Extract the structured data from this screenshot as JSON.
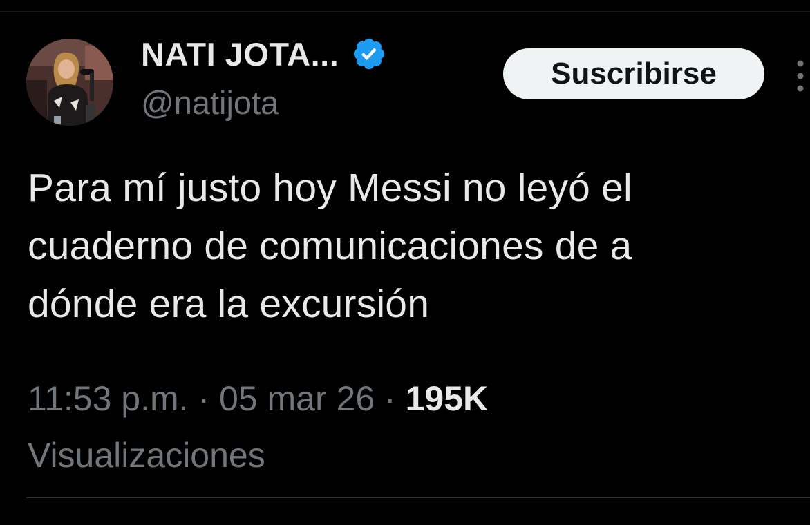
{
  "author": {
    "display_name": "NATI JOTA...",
    "handle": "@natijota",
    "verified": true,
    "avatar_icon": "profile-photo"
  },
  "actions": {
    "subscribe_label": "Suscribirse",
    "more_icon": "more-vertical-icon"
  },
  "tweet": {
    "text_lines": [
      "Para mí justo hoy Messi no leyó el",
      "cuaderno de comunicaciones de a",
      "dónde era la excursión"
    ],
    "time": "11:53 p.m.",
    "separator": "·",
    "date": "05 mar 26",
    "views_count": "195K",
    "views_label": "Visualizaciones"
  },
  "colors": {
    "background": "#000000",
    "primary_text": "#e7e9ea",
    "secondary_text": "#71767b",
    "verified_badge": "#1d9bf0",
    "button_bg": "#eff3f4",
    "button_text": "#0f1419"
  }
}
